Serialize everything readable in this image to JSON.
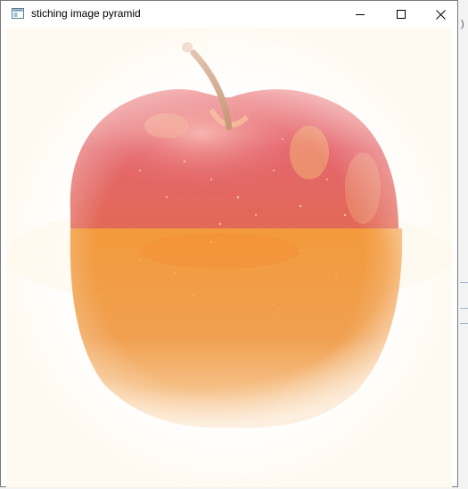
{
  "window": {
    "title": "stiching image pyramid",
    "icon": "window-app-icon",
    "controls": {
      "minimize": "minimize-icon",
      "maximize": "maximize-icon",
      "close": "close-icon"
    }
  },
  "content": {
    "image": "blended apple and orange image"
  },
  "background": {
    "fragment_text": ")"
  },
  "colors": {
    "apple_red": "#e0595f",
    "orange": "#f0953a",
    "stem": "#c9997a",
    "window_border": "#7a7a7a",
    "close_hover": "#e81123"
  }
}
